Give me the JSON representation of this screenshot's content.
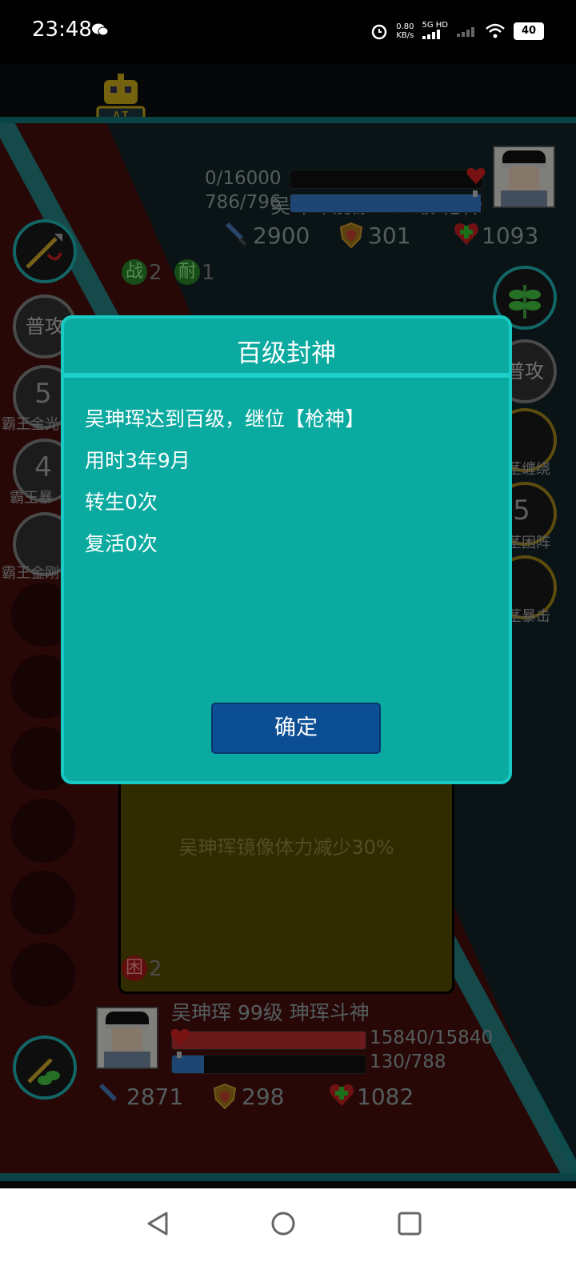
{
  "status_bar": {
    "time": "23:48",
    "net_speed_top": "0.80",
    "net_speed_bottom": "KB/s",
    "network": "5G HD",
    "battery": "40"
  },
  "enemy": {
    "name_line": "吴珅珲镜像 100级 枪神",
    "hp": "0/16000",
    "mp": "786/796",
    "hp_fraction": 0,
    "mp_fraction": 0.99,
    "attack": "2900",
    "defense": "301",
    "heal": "1093",
    "badges": [
      {
        "label": "战",
        "count": "2"
      },
      {
        "label": "耐",
        "count": "1"
      }
    ],
    "skills": [
      {
        "label": "普攻"
      },
      {
        "num": "",
        "label": "茎缠绕"
      },
      {
        "num": "5",
        "label": "茎困阵"
      },
      {
        "num": "",
        "label": "茎暴击"
      }
    ]
  },
  "player": {
    "name_line": "吴珅珲 99级 珅珲斗神",
    "hp": "15840/15840",
    "mp": "130/788",
    "hp_fraction": 1,
    "mp_fraction": 0.165,
    "attack": "2871",
    "defense": "298",
    "heal": "1082",
    "badge": {
      "label": "困",
      "count": "2"
    },
    "skills": [
      {
        "label": "普攻"
      },
      {
        "num": "5",
        "label": "霸王金光"
      },
      {
        "num": "4",
        "label": "霸王暴"
      },
      {
        "num": "",
        "label": "霸王金刚"
      }
    ]
  },
  "card": {
    "effect_text": "吴珅珲镜像体力减少30%"
  },
  "dialog": {
    "title": "百级封神",
    "lines": [
      "吴珅珲达到百级，继位【枪神】",
      "用时3年9月",
      "转生0次",
      "复活0次"
    ],
    "ok_label": "确定"
  },
  "ai_badge": "AI",
  "colors": {
    "dialog_bg": "#0baaa0",
    "dialog_border": "#19c9c4",
    "ok_button": "#0b4e94",
    "hp_red": "#c23030",
    "mp_blue": "#3a7fd0"
  },
  "icons": {
    "attack": "sword-icon",
    "defense": "shield-icon",
    "heal": "heart-cross-icon",
    "nav_back": "back-triangle-icon",
    "nav_home": "home-circle-icon",
    "nav_recents": "recents-square-icon"
  }
}
